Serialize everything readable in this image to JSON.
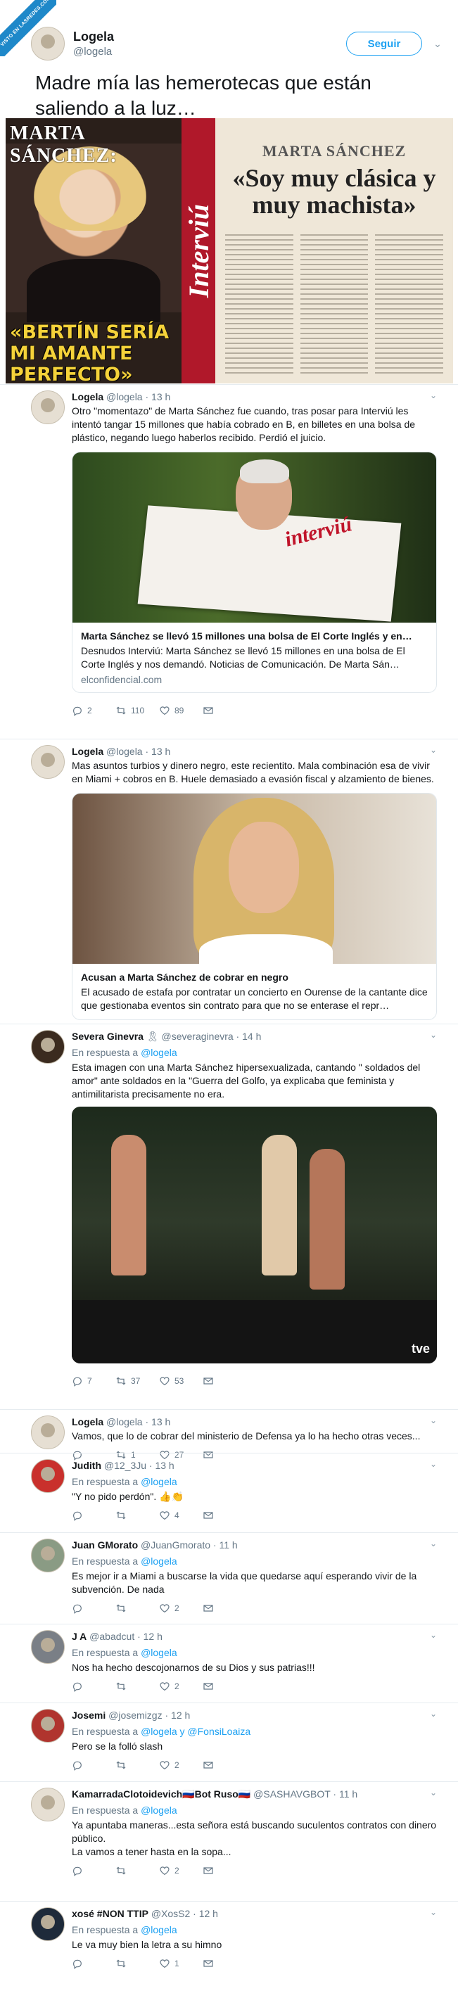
{
  "watermark": "VISTO EN LASREDES.COM",
  "main": {
    "name": "Logela",
    "handle": "@logela",
    "follow_label": "Seguir",
    "text": "Madre mía las hemerotecas que están saliendo a la luz…",
    "magazine": {
      "name_left": "MARTA SÁNCHEZ:",
      "headline_left": "«BERTÍN SERÍA MI AMANTE PERFECTO»",
      "spine": "Interviú",
      "name_right": "MARTA SÁNCHEZ",
      "quote_right": "«Soy muy clásica y muy machista»"
    }
  },
  "replies": [
    {
      "name": "Logela",
      "meta": "@logela · 13 h",
      "text": "Otro \"momentazo\" de Marta Sánchez fue cuando, tras posar para Interviú les intentó tangar 15 millones que había cobrado en B, en billetes en una bolsa de plástico, negando luego haberlos recibido. Perdió el juicio.",
      "card": {
        "title": "Marta Sánchez se llevó 15 millones una bolsa de El Corte Inglés y en…",
        "desc": "Desnudos Interviú: Marta Sánchez se llevó 15 millones en una bolsa de El Corte Inglés y nos demandó. Noticias de Comunicación. De Marta Sán…",
        "domain": "elconfidencial.com",
        "magazine_word": "interviú"
      },
      "counts": {
        "reply": "2",
        "retweet": "110",
        "like": "89"
      }
    },
    {
      "name": "Logela",
      "meta": "@logela · 13 h",
      "text": "Mas asuntos turbios y dinero negro, este recientito. Mala combinación esa de vivir en Miami + cobros en B. Huele demasiado a evasión fiscal y alzamiento de bienes.",
      "card": {
        "title": "Acusan a Marta Sánchez de cobrar en negro",
        "desc": "El acusado de estafa por contratar un concierto en Ourense de la cantante dice que gestionaba eventos sin contrato para que no se enterase el repr…"
      }
    },
    {
      "name": "Severa Ginevra",
      "meta": "🎗 @severaginevra · 14 h",
      "in_reply_prefix": "En respuesta a",
      "in_reply_to": "@logela",
      "text": "Esta imagen con una Marta Sánchez hipersexualizada, cantando \" soldados del amor\" ante soldados en la \"Guerra del Golfo, ya explicaba que feminista y antimilitarista precisamente no era.",
      "media_label": "tve",
      "counts": {
        "reply": "7",
        "retweet": "37",
        "like": "53"
      }
    },
    {
      "name": "Logela",
      "meta": "@logela · 13 h",
      "text": "Vamos, que lo de cobrar del ministerio de Defensa ya lo ha hecho otras veces...",
      "counts": {
        "reply": "",
        "retweet": "1",
        "like": "27"
      }
    },
    {
      "name": "Judith",
      "meta": "@12_3Ju · 13 h",
      "in_reply_prefix": "En respuesta a",
      "in_reply_to": "@logela",
      "text": "\"Y no pido perdón\". 👍👏",
      "counts": {
        "reply": "",
        "retweet": "",
        "like": "4"
      }
    },
    {
      "name": "Juan GMorato",
      "meta": "@JuanGmorato · 11 h",
      "in_reply_prefix": "En respuesta a",
      "in_reply_to": "@logela",
      "text": "Es mejor ir a Miami a buscarse la vida que quedarse aquí esperando vivir de la subvención. De nada",
      "counts": {
        "reply": "",
        "retweet": "",
        "like": "2"
      }
    },
    {
      "name": "J A",
      "meta": "@abadcut · 12 h",
      "in_reply_prefix": "En respuesta a",
      "in_reply_to": "@logela",
      "text": "Nos ha hecho descojonarnos de su Dios y sus patrias!!!",
      "counts": {
        "reply": "",
        "retweet": "",
        "like": "2"
      }
    },
    {
      "name": "Josemi",
      "meta": "@josemizgz · 12 h",
      "in_reply_prefix": "En respuesta a",
      "in_reply_to": "@logela y @FonsiLoaiza",
      "text": "Pero se la folló slash",
      "counts": {
        "reply": "",
        "retweet": "",
        "like": "2"
      }
    },
    {
      "name": "KamarradaClotoidevich🇷🇺Bot Ruso🇷🇺",
      "meta": "@SASHAVGBOT · 11 h",
      "in_reply_prefix": "En respuesta a",
      "in_reply_to": "@logela",
      "text": "Ya apuntaba maneras...esta señora está buscando suculentos contratos con dinero público.\nLa vamos a tener hasta en la sopa...",
      "counts": {
        "reply": "",
        "retweet": "",
        "like": "2"
      }
    },
    {
      "name": "xosé #NON TTIP",
      "meta": "@XosS2 · 12 h",
      "in_reply_prefix": "En respuesta a",
      "in_reply_to": "@logela",
      "text": "Le va muy bien la letra a su himno",
      "counts": {
        "reply": "",
        "retweet": "",
        "like": "1"
      }
    }
  ]
}
